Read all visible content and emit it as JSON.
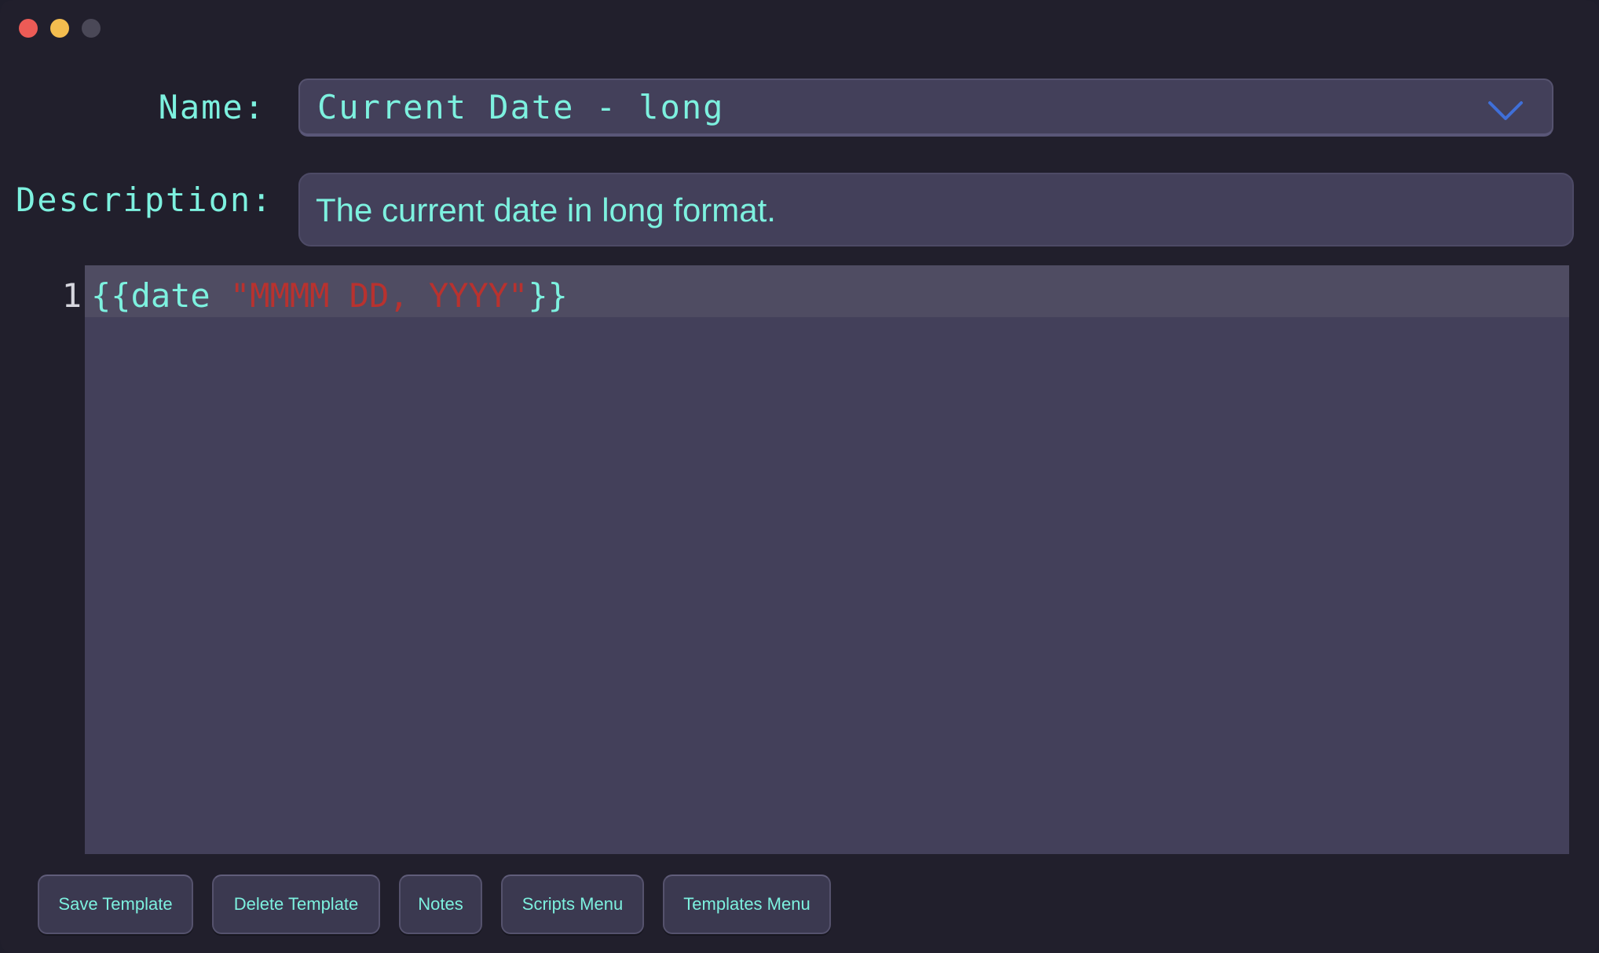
{
  "window": {
    "controls": [
      {
        "name": "close",
        "color": "#ec5b56"
      },
      {
        "name": "minimize",
        "color": "#f4bd4f"
      },
      {
        "name": "zoom",
        "color": "#4a4857"
      }
    ]
  },
  "form": {
    "name_label": "Name:",
    "name_value": "Current Date - long",
    "description_label": "Description:",
    "description_value": "The current date in long format."
  },
  "editor": {
    "lines": [
      {
        "number": "1",
        "tokens": [
          {
            "text": "{{date ",
            "type": "brace"
          },
          {
            "text": "\"MMMM DD, YYYY\"",
            "type": "string"
          },
          {
            "text": "}}",
            "type": "brace"
          }
        ]
      }
    ]
  },
  "toolbar": {
    "save_template": "Save Template",
    "delete_template": "Delete Template",
    "notes": "Notes",
    "scripts_menu": "Scripts Menu",
    "templates_menu": "Templates Menu"
  },
  "colors": {
    "accent_text": "#7df1df",
    "string_token": "#b8322f",
    "chevron": "#3f6fd8"
  }
}
